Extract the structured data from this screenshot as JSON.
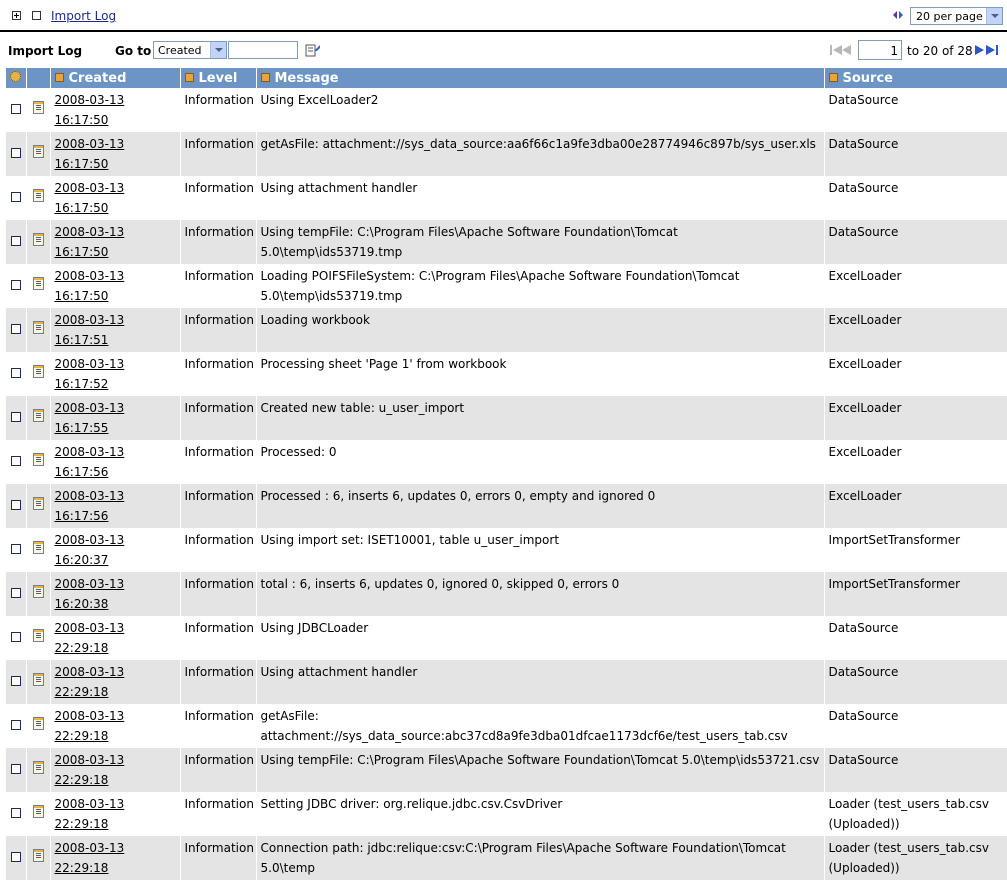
{
  "topbar": {
    "title": "Import Log",
    "per_page": "20 per page"
  },
  "list": {
    "title": "Import Log",
    "goto_label": "Go to",
    "goto_field": "Created",
    "goto_value": "",
    "page_input": "1",
    "page_range": "to 20 of 28"
  },
  "columns": {
    "created": "Created",
    "level": "Level",
    "message": "Message",
    "source": "Source"
  },
  "rows": [
    {
      "created": "2008-03-13 16:17:50",
      "level": "Information",
      "message": "Using ExcelLoader2",
      "source": "DataSource"
    },
    {
      "created": "2008-03-13 16:17:50",
      "level": "Information",
      "message": "getAsFile: attachment://sys_data_source:aa6f66c1a9fe3dba00e28774946c897b/sys_user.xls",
      "source": "DataSource"
    },
    {
      "created": "2008-03-13 16:17:50",
      "level": "Information",
      "message": "Using attachment handler",
      "source": "DataSource"
    },
    {
      "created": "2008-03-13 16:17:50",
      "level": "Information",
      "message": "Using tempFile: C:\\Program Files\\Apache Software Foundation\\Tomcat 5.0\\temp\\ids53719.tmp",
      "source": "DataSource"
    },
    {
      "created": "2008-03-13 16:17:50",
      "level": "Information",
      "message": "Loading POIFSFileSystem: C:\\Program Files\\Apache Software Foundation\\Tomcat 5.0\\temp\\ids53719.tmp",
      "source": "ExcelLoader"
    },
    {
      "created": "2008-03-13 16:17:51",
      "level": "Information",
      "message": "Loading workbook",
      "source": "ExcelLoader"
    },
    {
      "created": "2008-03-13 16:17:52",
      "level": "Information",
      "message": "Processing sheet 'Page 1' from workbook",
      "source": "ExcelLoader"
    },
    {
      "created": "2008-03-13 16:17:55",
      "level": "Information",
      "message": "Created new table: u_user_import",
      "source": "ExcelLoader"
    },
    {
      "created": "2008-03-13 16:17:56",
      "level": "Information",
      "message": "Processed: 0",
      "source": "ExcelLoader"
    },
    {
      "created": "2008-03-13 16:17:56",
      "level": "Information",
      "message": "Processed : 6, inserts 6, updates 0, errors 0, empty and ignored 0",
      "source": "ExcelLoader"
    },
    {
      "created": "2008-03-13 16:20:37",
      "level": "Information",
      "message": "Using import set: ISET10001, table u_user_import",
      "source": "ImportSetTransformer"
    },
    {
      "created": "2008-03-13 16:20:38",
      "level": "Information",
      "message": "total : 6, inserts 6, updates 0, ignored 0, skipped 0, errors 0",
      "source": "ImportSetTransformer"
    },
    {
      "created": "2008-03-13 22:29:18",
      "level": "Information",
      "message": "Using JDBCLoader",
      "source": "DataSource"
    },
    {
      "created": "2008-03-13 22:29:18",
      "level": "Information",
      "message": "Using attachment handler",
      "source": "DataSource"
    },
    {
      "created": "2008-03-13 22:29:18",
      "level": "Information",
      "message": "getAsFile: attachment://sys_data_source:abc37cd8a9fe3dba01dfcae1173dcf6e/test_users_tab.csv",
      "source": "DataSource"
    },
    {
      "created": "2008-03-13 22:29:18",
      "level": "Information",
      "message": "Using tempFile: C:\\Program Files\\Apache Software Foundation\\Tomcat 5.0\\temp\\ids53721.csv",
      "source": "DataSource"
    },
    {
      "created": "2008-03-13 22:29:18",
      "level": "Information",
      "message": "Setting JDBC driver: org.relique.jdbc.csv.CsvDriver",
      "source": "Loader (test_users_tab.csv (Uploaded))"
    },
    {
      "created": "2008-03-13 22:29:18",
      "level": "Information",
      "message": "Connection path: jdbc:relique:csv:C:\\Program Files\\Apache Software Foundation\\Tomcat 5.0\\temp",
      "source": "Loader (test_users_tab.csv (Uploaded))"
    }
  ]
}
